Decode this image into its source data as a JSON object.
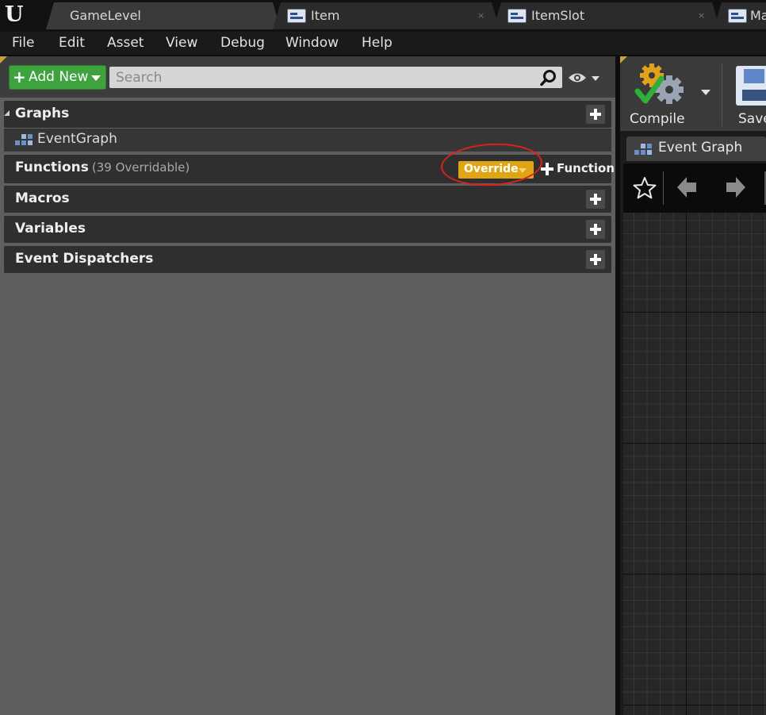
{
  "tabs": [
    {
      "label": "GameLevel",
      "active": true,
      "icon": "level-icon"
    },
    {
      "label": "Item",
      "active": false,
      "icon": "widget-blueprint-icon",
      "close": "×"
    },
    {
      "label": "ItemSlot",
      "active": false,
      "icon": "widget-blueprint-icon",
      "close": "×"
    },
    {
      "label": "Ma",
      "active": false,
      "icon": "widget-blueprint-icon"
    }
  ],
  "logo": "U",
  "menu": [
    "File",
    "Edit",
    "Asset",
    "View",
    "Debug",
    "Window",
    "Help"
  ],
  "my_blueprint": {
    "add_new_label": "Add New",
    "search_placeholder": "Search",
    "sections": {
      "graphs": {
        "title": "Graphs",
        "items": [
          "EventGraph"
        ]
      },
      "functions": {
        "title": "Functions",
        "subtitle": "(39 Overridable)",
        "override_label": "Override",
        "function_label": "Function"
      },
      "macros": {
        "title": "Macros"
      },
      "variables": {
        "title": "Variables"
      },
      "event_dispatchers": {
        "title": "Event Dispatchers"
      }
    }
  },
  "toolbar": {
    "compile_label": "Compile",
    "save_label": "Save"
  },
  "graph_editor": {
    "tab_label": "Event Graph"
  },
  "colors": {
    "add_new_green": "#3ea33e",
    "override_yellow": "#e0a515",
    "annotation_red": "#e0201c",
    "panel_gray": "#5f5f5f"
  }
}
